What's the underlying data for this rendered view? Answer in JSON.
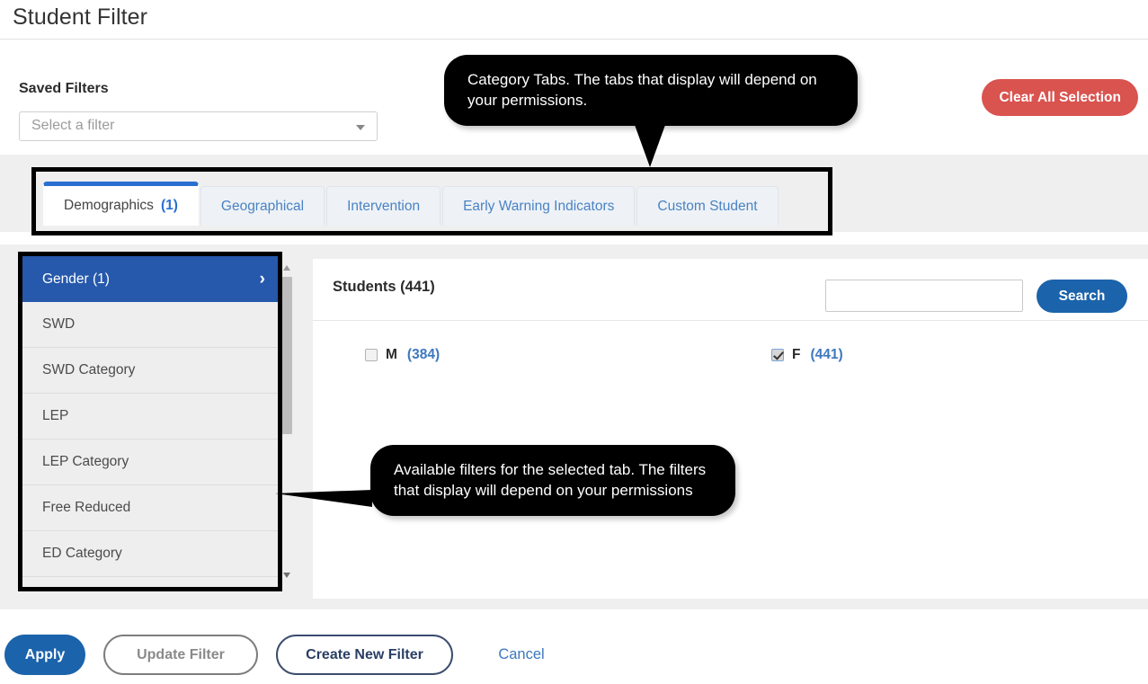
{
  "header": {
    "title": "Student Filter"
  },
  "saved_filters": {
    "label": "Saved Filters",
    "select_value": "Select a filter",
    "caret_icon": "chevron-down-icon"
  },
  "actions": {
    "clear_all_label": "Clear All Selection",
    "clear_all_color": "#d9534f"
  },
  "tabs": [
    {
      "label": "Demographics",
      "count": "(1)",
      "active": true
    },
    {
      "label": "Geographical",
      "count": "",
      "active": false
    },
    {
      "label": "Intervention",
      "count": "",
      "active": false
    },
    {
      "label": "Early Warning Indicators",
      "count": "",
      "active": false
    },
    {
      "label": "Custom Student",
      "count": "",
      "active": false
    }
  ],
  "sidebar": {
    "items": [
      {
        "label": "Gender (1)",
        "active": true,
        "chevron": "›"
      },
      {
        "label": "SWD",
        "active": false
      },
      {
        "label": "SWD Category",
        "active": false
      },
      {
        "label": "LEP",
        "active": false
      },
      {
        "label": "LEP Category",
        "active": false
      },
      {
        "label": "Free Reduced",
        "active": false
      },
      {
        "label": "ED Category",
        "active": false
      }
    ]
  },
  "content": {
    "students_title": "Students (441)",
    "search_value": "",
    "search_placeholder": "",
    "search_button": "Search",
    "options": [
      {
        "label": "M",
        "count": "(384)",
        "checked": false
      },
      {
        "label": "F",
        "count": "(441)",
        "checked": true
      }
    ]
  },
  "callouts": {
    "tabs_note": "Category Tabs. The tabs that display will depend on your permissions.",
    "filters_note": "Available filters for the selected tab. The filters that display will depend on your permissions"
  },
  "footer": {
    "apply": "Apply",
    "update_filter": "Update Filter",
    "create_new_filter": "Create New Filter",
    "cancel": "Cancel"
  },
  "colors": {
    "primary_blue": "#1b63ab",
    "tab_blue": "#2a6fd0",
    "sidebar_active": "#2659ac",
    "danger_red": "#d9534f",
    "link_blue": "#3c78bf"
  }
}
